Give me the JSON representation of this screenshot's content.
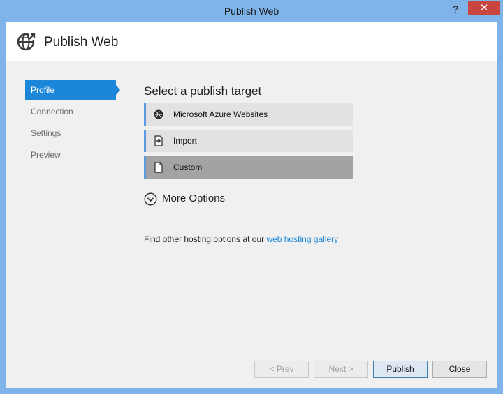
{
  "window": {
    "title": "Publish Web",
    "help_glyph": "?",
    "close_glyph": "✕"
  },
  "header": {
    "title": "Publish Web",
    "icon": "globe-publish-icon"
  },
  "nav": {
    "items": [
      {
        "label": "Profile",
        "active": true
      },
      {
        "label": "Connection",
        "active": false
      },
      {
        "label": "Settings",
        "active": false
      },
      {
        "label": "Preview",
        "active": false
      }
    ]
  },
  "main": {
    "title": "Select a publish target",
    "targets": [
      {
        "label": "Microsoft Azure Websites",
        "icon": "azure-icon",
        "selected": false
      },
      {
        "label": "Import",
        "icon": "import-icon",
        "selected": false
      },
      {
        "label": "Custom",
        "icon": "document-icon",
        "selected": true
      }
    ],
    "more_options": "More Options",
    "hosting_text": "Find other hosting options at our",
    "hosting_link": "web hosting gallery"
  },
  "footer": {
    "prev": "< Prev",
    "next": "Next >",
    "publish": "Publish",
    "close": "Close"
  },
  "colors": {
    "frame": "#7eb4ea",
    "accent": "#1c86d8",
    "close_button": "#c7463f",
    "selected_target": "#a3a3a3"
  }
}
